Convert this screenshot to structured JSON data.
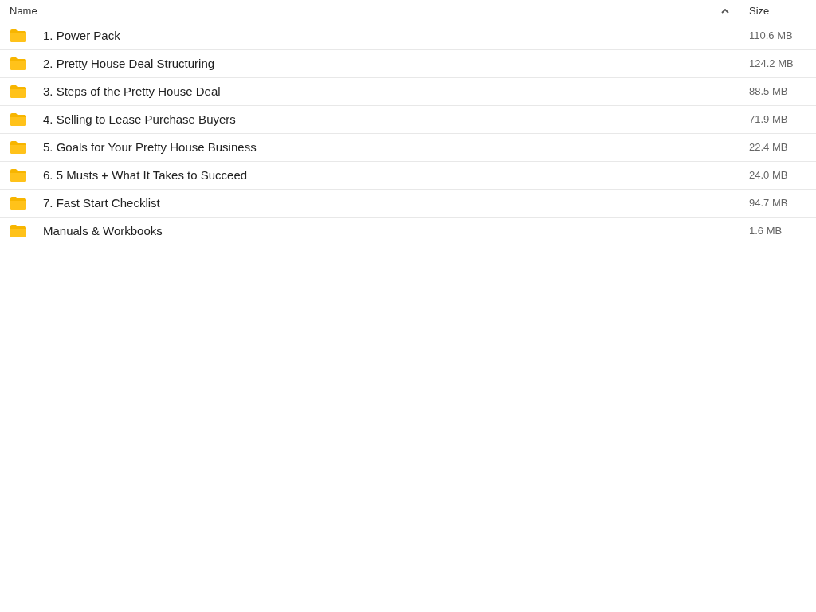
{
  "table": {
    "columns": [
      {
        "label": "Name",
        "sorted": true
      },
      {
        "label": "Size",
        "sorted": false
      }
    ],
    "rows": [
      {
        "kind": "folder",
        "name": "1. Power Pack",
        "size": "110.6 MB"
      },
      {
        "kind": "folder",
        "name": "2. Pretty House Deal Structuring",
        "size": "124.2 MB"
      },
      {
        "kind": "folder",
        "name": "3. Steps of the Pretty House Deal",
        "size": "88.5 MB"
      },
      {
        "kind": "folder",
        "name": "4. Selling to Lease Purchase Buyers",
        "size": "71.9 MB"
      },
      {
        "kind": "folder",
        "name": "5. Goals for Your Pretty House Business",
        "size": "22.4 MB"
      },
      {
        "kind": "folder",
        "name": "6. 5 Musts + What It Takes to Succeed",
        "size": "24.0 MB"
      },
      {
        "kind": "folder",
        "name": "7. Fast Start Checklist",
        "size": "94.7 MB"
      },
      {
        "kind": "folder",
        "name": "Manuals & Workbooks",
        "size": "1.6 MB"
      }
    ]
  }
}
